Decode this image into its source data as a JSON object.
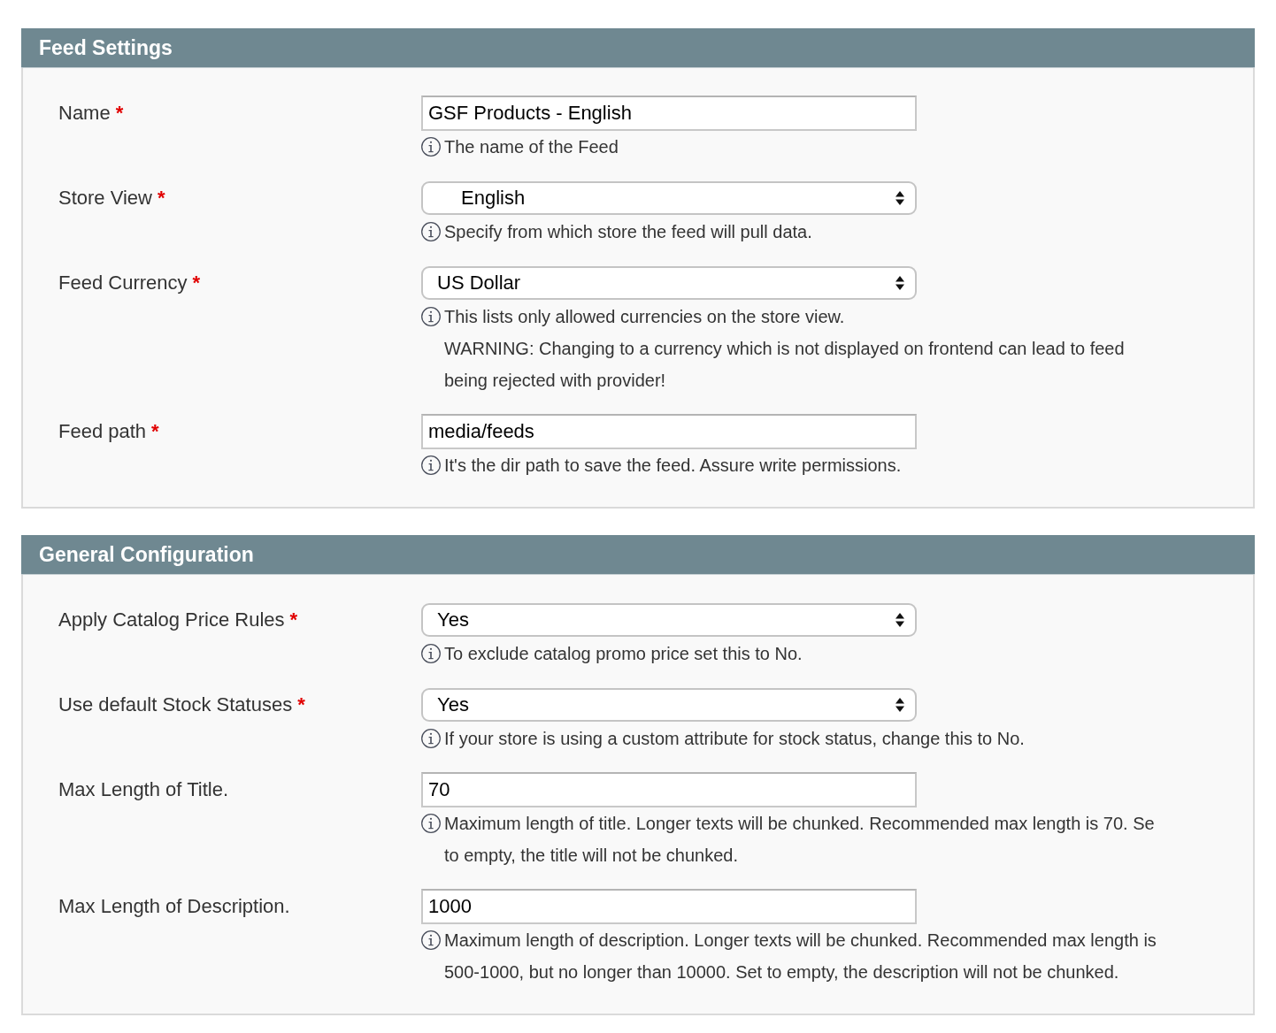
{
  "sections": [
    {
      "title": "Feed Settings",
      "fields": [
        {
          "label": "Name",
          "required_mark": "*",
          "kind": "text",
          "value": "GSF Products - English",
          "hint": [
            "The name of the Feed"
          ]
        },
        {
          "label": "Store View",
          "required_mark": "*",
          "kind": "select",
          "indented": true,
          "value": "English",
          "hint": [
            "Specify from which store the feed will pull data."
          ]
        },
        {
          "label": "Feed Currency",
          "required_mark": "*",
          "kind": "select",
          "indented": false,
          "value": "US Dollar",
          "hint": [
            "This lists only allowed currencies on the store view.",
            "WARNING: Changing to a currency which is not displayed on frontend can lead to feed",
            "being rejected with provider!"
          ]
        },
        {
          "label": "Feed path",
          "required_mark": "*",
          "kind": "text",
          "value": "media/feeds",
          "hint": [
            "It's the dir path to save the feed. Assure write permissions."
          ]
        }
      ]
    },
    {
      "title": "General Configuration",
      "fields": [
        {
          "label": "Apply Catalog Price Rules",
          "required_mark": "*",
          "kind": "select",
          "indented": false,
          "value": "Yes",
          "hint": [
            "To exclude catalog promo price set this to No."
          ]
        },
        {
          "label": "Use default Stock Statuses",
          "required_mark": "*",
          "kind": "select",
          "indented": false,
          "value": "Yes",
          "hint": [
            "If your store is using a custom attribute for stock status, change this to No."
          ]
        },
        {
          "label": "Max Length of Title.",
          "kind": "text",
          "value": "70",
          "hint": [
            "Maximum length of title. Longer texts will be chunked. Recommended max length is 70. Se",
            "to empty, the title will not be chunked."
          ]
        },
        {
          "label": "Max Length of Description.",
          "kind": "text",
          "value": "1000",
          "hint": [
            "Maximum length of description. Longer texts will be chunked. Recommended max length is",
            "500-1000, but no longer than 10000. Set to empty, the description will not be chunked."
          ]
        }
      ]
    }
  ]
}
